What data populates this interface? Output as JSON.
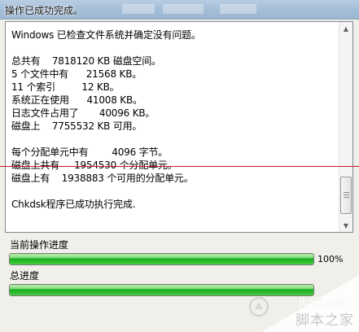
{
  "window": {
    "title": "操作已成功完成。"
  },
  "log": {
    "lines": [
      "Windows 已检查文件系统并确定没有问题。",
      "",
      "总共有    7818120 KB 磁盘空间。",
      "5 个文件中有      21568 KB。",
      "11 个索引         12 KB。",
      "系统正在使用      41008 KB。",
      "日志文件占用了       40096 KB。",
      "磁盘上    7755532 KB 可用。",
      "",
      "每个分配单元中有        4096 字节。",
      "磁盘上共有     1954530 个分配单元。",
      "磁盘上有    1938883 个可用的分配单元。",
      "",
      "Chkdsk程序已成功执行完成."
    ]
  },
  "progress": {
    "current": {
      "label": "当前操作进度",
      "percent_text": "100%",
      "fraction": 1.0
    },
    "total": {
      "label": "总进度",
      "fraction": 1.0
    }
  },
  "watermark": {
    "url": "jb51.net",
    "name": "脚本之家",
    "logo_icon": "jb51-logo-icon"
  },
  "colors": {
    "progress_green": "#1fae22",
    "red_line": "#c41e1e"
  }
}
